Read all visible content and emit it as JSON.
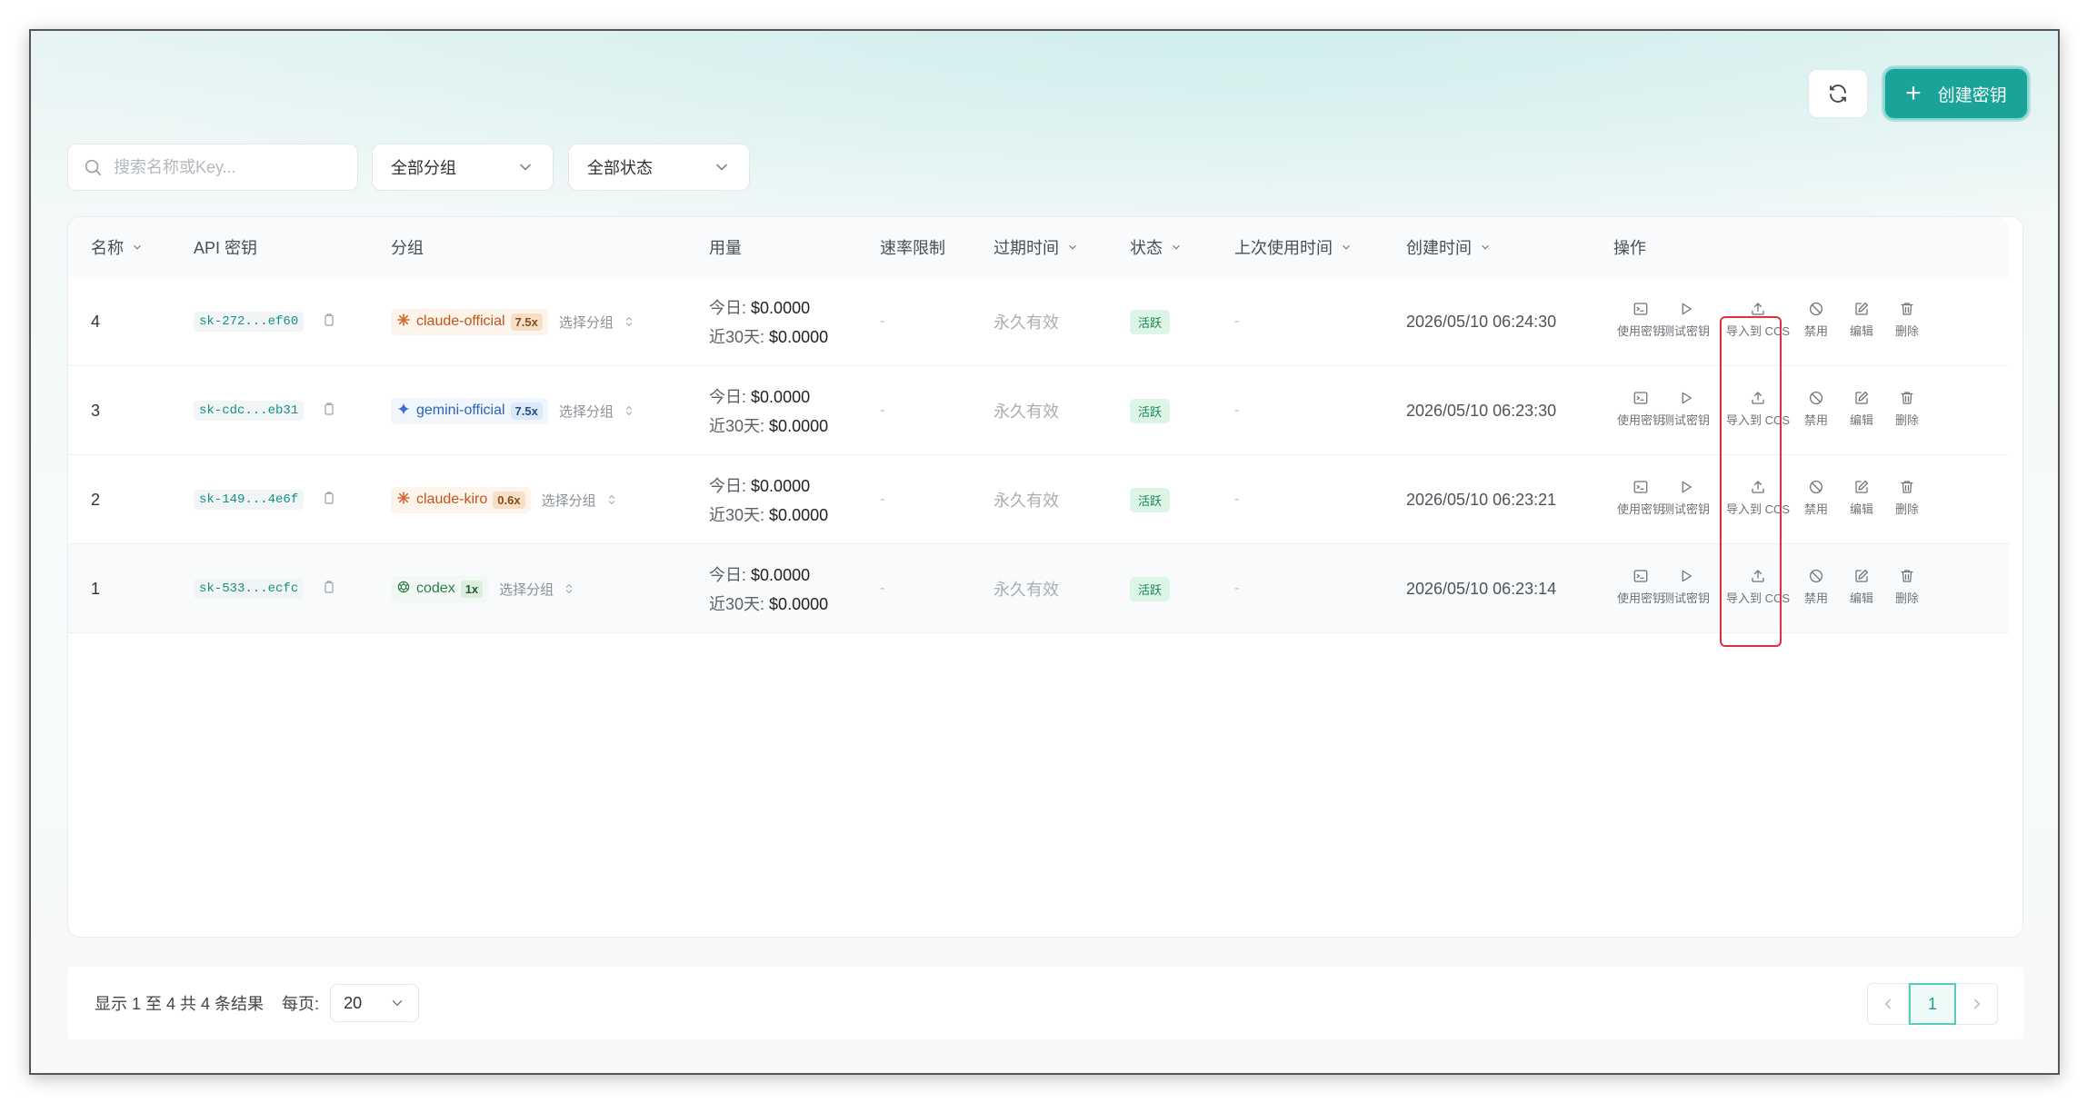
{
  "toolbar": {
    "create_label": "创建密钥"
  },
  "filters": {
    "search_placeholder": "搜索名称或Key...",
    "group_select": "全部分组",
    "status_select": "全部状态"
  },
  "table": {
    "columns": {
      "name": "名称",
      "api_key": "API 密钥",
      "group": "分组",
      "usage": "用量",
      "rate_limit": "速率限制",
      "expire": "过期时间",
      "status": "状态",
      "last_used": "上次使用时间",
      "created": "创建时间",
      "actions": "操作"
    },
    "rows": [
      {
        "name": "4",
        "key": "sk-272...ef60",
        "group": "claude-official",
        "multiplier": "7.5x",
        "group_style": "orange",
        "group_icon": "claude-icon",
        "pick_group": "选择分组",
        "usage_today_label": "今日:",
        "usage_today": "$0.0000",
        "usage_30d_label": "近30天:",
        "usage_30d": "$0.0000",
        "rate_limit": "-",
        "expire": "永久有效",
        "status": "活跃",
        "last_used": "-",
        "created": "2026/05/10 06:24:30"
      },
      {
        "name": "3",
        "key": "sk-cdc...eb31",
        "group": "gemini-official",
        "multiplier": "7.5x",
        "group_style": "blue",
        "group_icon": "gemini-icon",
        "pick_group": "选择分组",
        "usage_today_label": "今日:",
        "usage_today": "$0.0000",
        "usage_30d_label": "近30天:",
        "usage_30d": "$0.0000",
        "rate_limit": "-",
        "expire": "永久有效",
        "status": "活跃",
        "last_used": "-",
        "created": "2026/05/10 06:23:30"
      },
      {
        "name": "2",
        "key": "sk-149...4e6f",
        "group": "claude-kiro",
        "multiplier": "0.6x",
        "group_style": "orange",
        "group_icon": "claude-icon",
        "pick_group": "选择分组",
        "usage_today_label": "今日:",
        "usage_today": "$0.0000",
        "usage_30d_label": "近30天:",
        "usage_30d": "$0.0000",
        "rate_limit": "-",
        "expire": "永久有效",
        "status": "活跃",
        "last_used": "-",
        "created": "2026/05/10 06:23:21"
      },
      {
        "name": "1",
        "key": "sk-533...ecfc",
        "group": "codex",
        "multiplier": "1x",
        "group_style": "green",
        "group_icon": "openai-icon",
        "pick_group": "选择分组",
        "usage_today_label": "今日:",
        "usage_today": "$0.0000",
        "usage_30d_label": "近30天:",
        "usage_30d": "$0.0000",
        "rate_limit": "-",
        "expire": "永久有效",
        "status": "活跃",
        "last_used": "-",
        "created": "2026/05/10 06:23:14"
      }
    ],
    "actions": [
      {
        "label": "使用密钥",
        "icon": "terminal-icon"
      },
      {
        "label": "测试密钥",
        "icon": "play-icon"
      },
      {
        "label": "导入到 CCS",
        "icon": "upload-icon"
      },
      {
        "label": "禁用",
        "icon": "ban-icon"
      },
      {
        "label": "编辑",
        "icon": "edit-icon"
      },
      {
        "label": "删除",
        "icon": "trash-icon"
      }
    ]
  },
  "footer": {
    "summary": "显示 1 至 4 共 4 条结果",
    "per_page_label": "每页:",
    "per_page_value": "20",
    "current_page": "1"
  },
  "colors": {
    "accent": "#1aa398",
    "status_active": "#138a4a",
    "highlight": "#e0313a"
  }
}
